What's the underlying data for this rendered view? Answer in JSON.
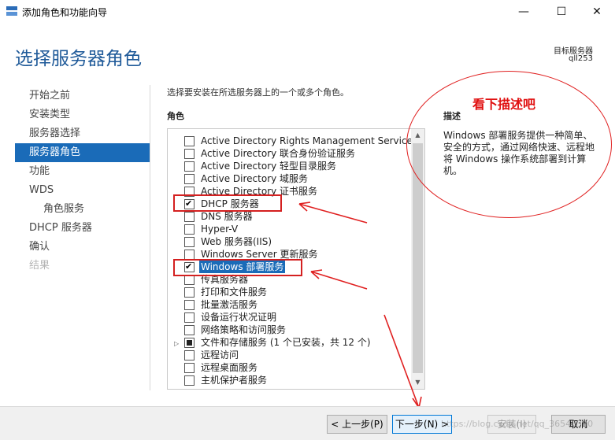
{
  "window": {
    "title": "添加角色和功能向导",
    "minimize": "—",
    "maximize": "☐",
    "close": "✕"
  },
  "header": {
    "page_title": "选择服务器角色",
    "target_label": "目标服务器",
    "target_value": "qll253"
  },
  "nav": {
    "items": [
      {
        "label": "开始之前",
        "state": "normal"
      },
      {
        "label": "安装类型",
        "state": "normal"
      },
      {
        "label": "服务器选择",
        "state": "normal"
      },
      {
        "label": "服务器角色",
        "state": "active"
      },
      {
        "label": "功能",
        "state": "normal"
      },
      {
        "label": "WDS",
        "state": "normal"
      },
      {
        "label": "角色服务",
        "state": "sub"
      },
      {
        "label": "DHCP 服务器",
        "state": "normal"
      },
      {
        "label": "确认",
        "state": "normal"
      },
      {
        "label": "结果",
        "state": "disabled"
      }
    ]
  },
  "main": {
    "instruction": "选择要安装在所选服务器上的一个或多个角色。",
    "roles_header": "角色",
    "roles": [
      {
        "label": "Active Directory Rights Management Services",
        "state": "unchecked"
      },
      {
        "label": "Active Directory 联合身份验证服务",
        "state": "unchecked"
      },
      {
        "label": "Active Directory 轻型目录服务",
        "state": "unchecked"
      },
      {
        "label": "Active Directory 域服务",
        "state": "unchecked"
      },
      {
        "label": "Active Directory 证书服务",
        "state": "unchecked"
      },
      {
        "label": "DHCP 服务器",
        "state": "checked"
      },
      {
        "label": "DNS 服务器",
        "state": "unchecked"
      },
      {
        "label": "Hyper-V",
        "state": "unchecked"
      },
      {
        "label": "Web 服务器(IIS)",
        "state": "unchecked"
      },
      {
        "label": "Windows Server 更新服务",
        "state": "unchecked"
      },
      {
        "label": "Windows 部署服务",
        "state": "checked",
        "selected": true
      },
      {
        "label": "传真服务器",
        "state": "unchecked"
      },
      {
        "label": "打印和文件服务",
        "state": "unchecked"
      },
      {
        "label": "批量激活服务",
        "state": "unchecked"
      },
      {
        "label": "设备运行状况证明",
        "state": "unchecked"
      },
      {
        "label": "网络策略和访问服务",
        "state": "unchecked"
      },
      {
        "label": "文件和存储服务 (1 个已安装，共 12 个)",
        "state": "partial",
        "expandable": true
      },
      {
        "label": "远程访问",
        "state": "unchecked"
      },
      {
        "label": "远程桌面服务",
        "state": "unchecked"
      },
      {
        "label": "主机保护者服务",
        "state": "unchecked"
      }
    ],
    "description_header": "描述",
    "description": "Windows 部署服务提供一种简单、安全的方式，通过网络快速、远程地将 Windows 操作系统部署到计算机。"
  },
  "annotation": {
    "text": "看下描述吧",
    "color": "#e01010"
  },
  "footer": {
    "back": "< 上一步(P)",
    "next": "下一步(N) >",
    "install": "安装(I)",
    "cancel": "取消",
    "watermark": "https://blog.csdn.net/qq_36540300"
  },
  "colors": {
    "accent": "#1a6bb8",
    "title": "#1f5a99",
    "annotation": "#e02020"
  }
}
